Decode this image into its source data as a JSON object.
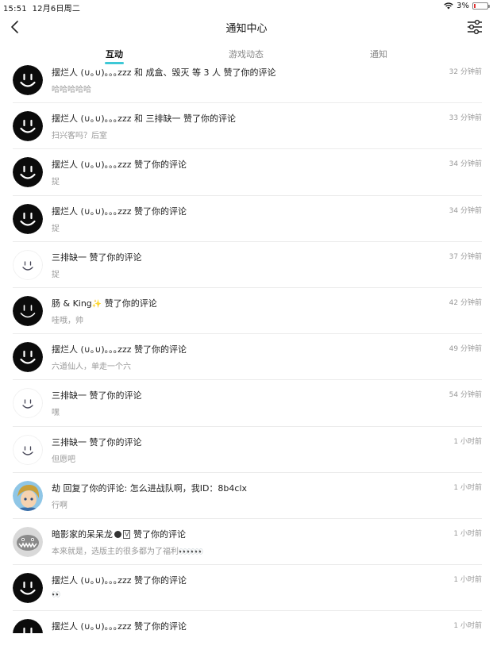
{
  "status": {
    "time": "15:51",
    "date": "12月6日周二",
    "battery": "3%"
  },
  "header": {
    "title": "通知中心"
  },
  "tabs": [
    {
      "label": "互动",
      "active": true
    },
    {
      "label": "游戏动态",
      "active": false
    },
    {
      "label": "通知",
      "active": false
    }
  ],
  "items": [
    {
      "avatar": "smiley-black",
      "title": "摆烂人 (∪｡∪)｡｡｡zzz 和 成盒、毁灭 等 3 人 赞了你的评论",
      "sub": "哈哈哈哈哈",
      "time": "32 分钟前"
    },
    {
      "avatar": "smiley-black",
      "title": "摆烂人 (∪｡∪)｡｡｡zzz 和 三排缺一 赞了你的评论",
      "sub": "扫兴客吗？后室",
      "time": "33 分钟前"
    },
    {
      "avatar": "smiley-black",
      "title": "摆烂人 (∪｡∪)｡｡｡zzz 赞了你的评论",
      "sub": "捉",
      "time": "34 分钟前"
    },
    {
      "avatar": "smiley-black",
      "title": "摆烂人 (∪｡∪)｡｡｡zzz 赞了你的评论",
      "sub": "捉",
      "time": "34 分钟前"
    },
    {
      "avatar": "smiley-white",
      "title": "三排缺一 赞了你的评论",
      "sub": "捉",
      "time": "37 分钟前"
    },
    {
      "avatar": "smiley-black-thin",
      "title": "肠 & King",
      "title_suffix": " 赞了你的评论",
      "sparkle": "✨",
      "sub": "哇哦，帅",
      "time": "42 分钟前"
    },
    {
      "avatar": "smiley-black",
      "title": "摆烂人 (∪｡∪)｡｡｡zzz 赞了你的评论",
      "sub": "六道仙人，单走一个六",
      "time": "49 分钟前"
    },
    {
      "avatar": "smiley-white",
      "title": "三排缺一 赞了你的评论",
      "sub": "嘿",
      "time": "54 分钟前"
    },
    {
      "avatar": "smiley-white",
      "title": "三排缺一 赞了你的评论",
      "sub": "但愿吧",
      "time": "1 小时前"
    },
    {
      "avatar": "anime-boy",
      "title": "劫 回复了你的评论: 怎么进战队啊，我ID：8b4clx",
      "sub": "行啊",
      "time": "1 小时前"
    },
    {
      "avatar": "shark",
      "title": "暗影家的呆呆龙",
      "badge": "V",
      "title_suffix": "  赞了你的评论",
      "sub": "本来就是，选版主的很多都为了福利",
      "sub_suffix": "👀👀👀",
      "time": "1 小时前"
    },
    {
      "avatar": "smiley-black",
      "title": "摆烂人 (∪｡∪)｡｡｡zzz 赞了你的评论",
      "sub": "",
      "sub_suffix": "👀",
      "time": "1 小时前"
    },
    {
      "avatar": "smiley-black",
      "title": "摆烂人 (∪｡∪)｡｡｡zzz 赞了你的评论",
      "sub": "",
      "time": "1 小时前"
    }
  ],
  "colors": {
    "accent": "#3ec8d6",
    "battery_low": "#e03030"
  }
}
